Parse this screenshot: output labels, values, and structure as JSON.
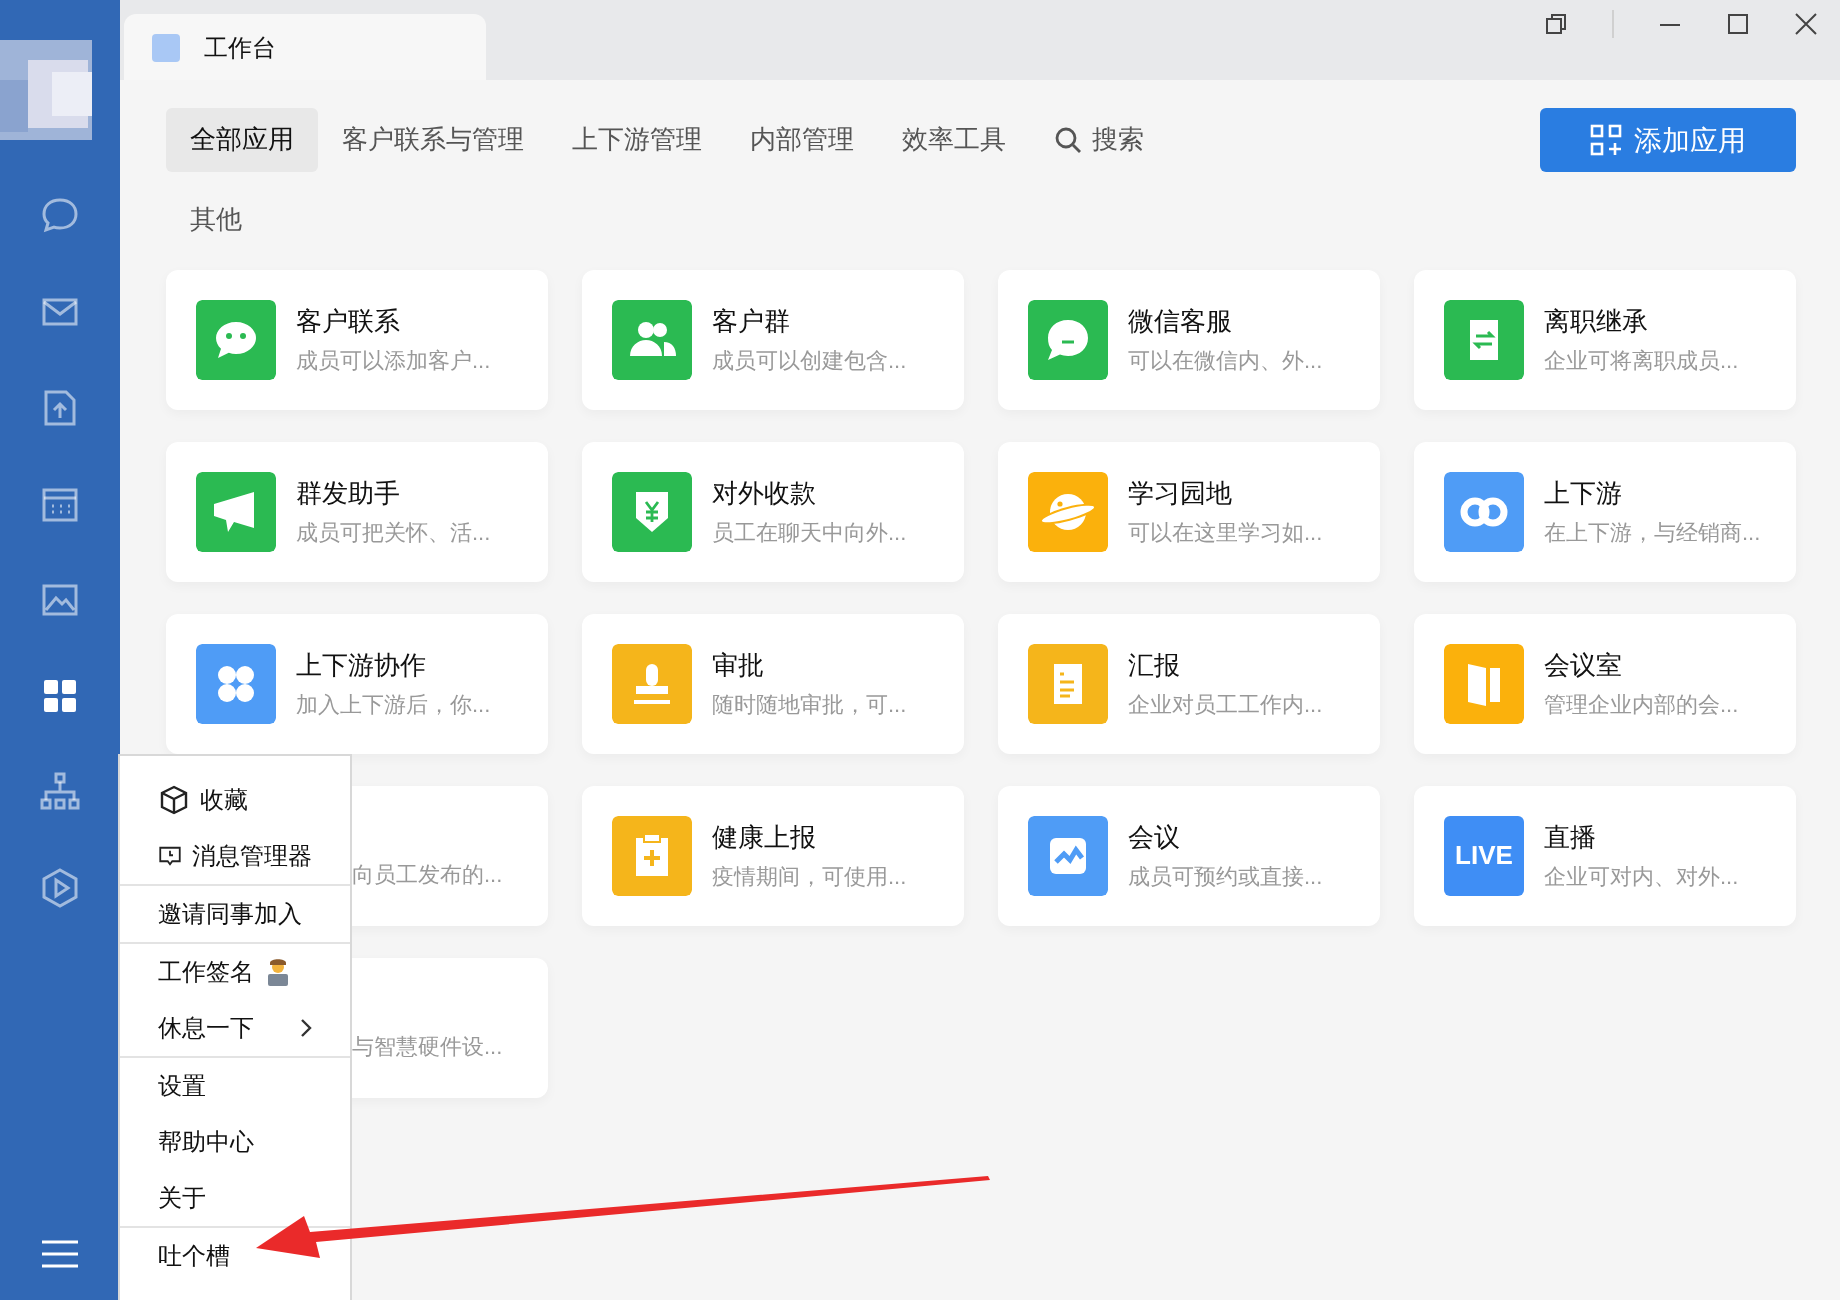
{
  "window": {
    "tab_title": "工作台"
  },
  "sidebar": {
    "items": [
      {
        "selected": false
      },
      {
        "selected": false
      },
      {
        "selected": false
      },
      {
        "selected": false
      },
      {
        "selected": false
      },
      {
        "selected": true
      },
      {
        "selected": false
      },
      {
        "selected": false
      }
    ]
  },
  "categories": [
    {
      "label": "全部应用",
      "selected": true
    },
    {
      "label": "客户联系与管理",
      "selected": false
    },
    {
      "label": "上下游管理",
      "selected": false
    },
    {
      "label": "内部管理",
      "selected": false
    },
    {
      "label": "效率工具",
      "selected": false
    },
    {
      "label": "其他",
      "selected": false
    }
  ],
  "search": {
    "label": "搜索"
  },
  "add_button": "添加应用",
  "apps": [
    {
      "title": "客户联系",
      "desc": "成员可以添加客户...",
      "color": "#2bba52"
    },
    {
      "title": "客户群",
      "desc": "成员可以创建包含...",
      "color": "#2bba52"
    },
    {
      "title": "微信客服",
      "desc": "可以在微信内、外...",
      "color": "#2bba52"
    },
    {
      "title": "离职继承",
      "desc": "企业可将离职成员...",
      "color": "#2bba52"
    },
    {
      "title": "群发助手",
      "desc": "成员可把关怀、活...",
      "color": "#2bba52"
    },
    {
      "title": "对外收款",
      "desc": "员工在聊天中向外...",
      "color": "#2bba52"
    },
    {
      "title": "学习园地",
      "desc": "可以在这里学习如...",
      "color": "#fbb10c"
    },
    {
      "title": "上下游",
      "desc": "在上下游，与经销商...",
      "color": "#4f9cf6"
    },
    {
      "title": "上下游协作",
      "desc": "加入上下游后，你...",
      "color": "#4f9cf6"
    },
    {
      "title": "审批",
      "desc": "随时随地审批，可...",
      "color": "#f5b51b"
    },
    {
      "title": "汇报",
      "desc": "企业对员工工作内...",
      "color": "#f5b51b"
    },
    {
      "title": "会议室",
      "desc": "管理企业内部的会...",
      "color": "#fbb10c"
    },
    {
      "desc": "向员工发布的..."
    },
    {
      "title": "健康上报",
      "desc": "疫情期间，可使用...",
      "color": "#f5b51b"
    },
    {
      "title": "会议",
      "desc": "成员可预约或直接...",
      "color": "#4f9cf6"
    },
    {
      "title": "直播",
      "desc": "企业可对内、对外...",
      "color": "#3f8ef5",
      "badge": "LIVE"
    },
    {
      "desc": "与智慧硬件设..."
    }
  ],
  "menu": [
    {
      "label": "收藏",
      "kind": "icon"
    },
    {
      "label": "消息管理器",
      "kind": "icon",
      "divider": true
    },
    {
      "label": "邀请同事加入",
      "kind": "plain",
      "divider": true
    },
    {
      "label": "工作签名",
      "kind": "emoji"
    },
    {
      "label": "休息一下",
      "kind": "submenu",
      "divider": true
    },
    {
      "label": "设置",
      "kind": "plain"
    },
    {
      "label": "帮助中心",
      "kind": "plain"
    },
    {
      "label": "关于",
      "kind": "plain",
      "divider": true
    },
    {
      "label": "吐个槽",
      "kind": "plain"
    }
  ]
}
